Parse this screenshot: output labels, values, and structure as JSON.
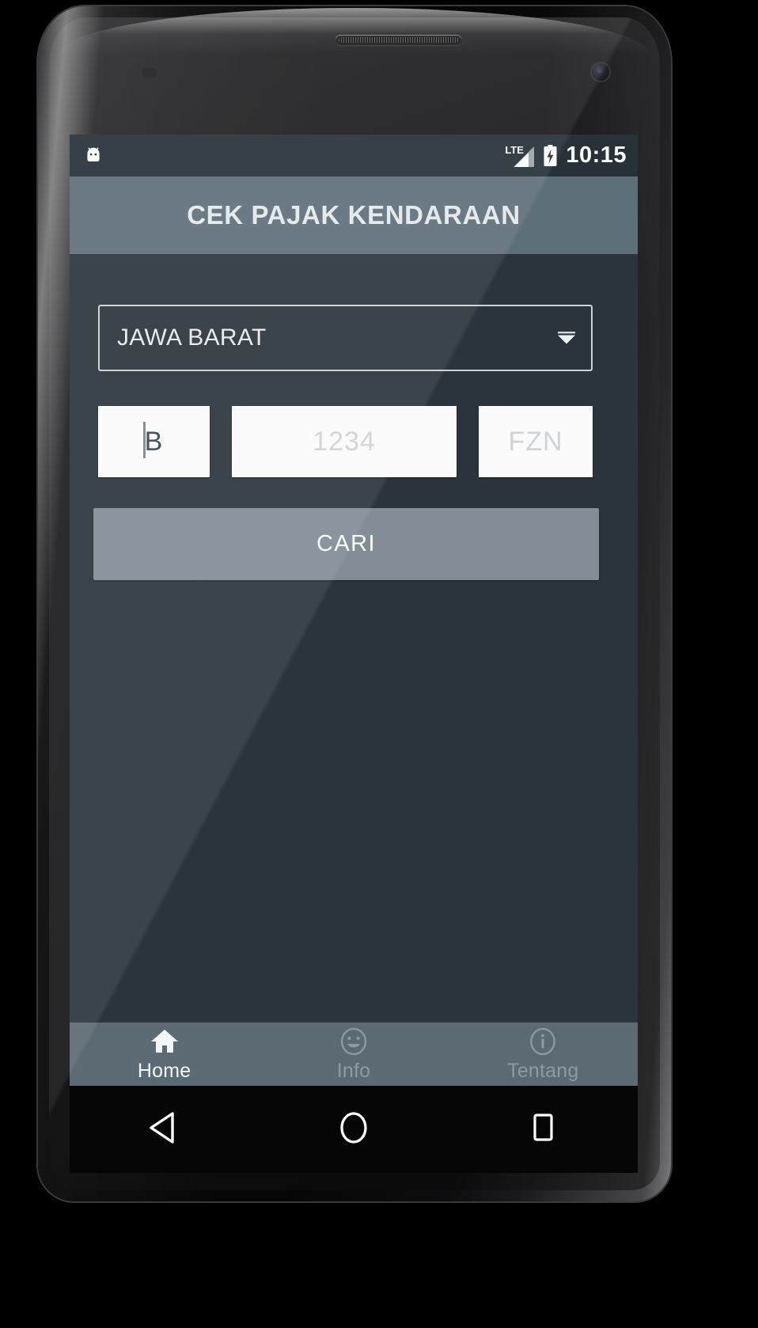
{
  "device": {
    "mockup": "android-phone-mockup",
    "earpiece": "earpiece-speaker",
    "camera": "front-camera",
    "sensor": "proximity-sensor"
  },
  "statusbar": {
    "notification_icon": "android-mascot-icon",
    "network_label": "LTE",
    "signal_icon": "signal-bars-icon",
    "battery_icon": "battery-charging-icon",
    "time": "10:15"
  },
  "actionbar": {
    "title": "CEK PAJAK KENDARAAN",
    "background": "#5f6f7a"
  },
  "form": {
    "region_spinner": {
      "value": "JAWA BARAT",
      "caret_icon": "chevron-down-icon"
    },
    "plate": {
      "code": {
        "value": "B",
        "placeholder": "B",
        "caret_visible": true
      },
      "number": {
        "value": "",
        "placeholder": "1234"
      },
      "suffix": {
        "value": "",
        "placeholder": "FZN"
      }
    },
    "submit_label": "CARI"
  },
  "tabbar": {
    "items": [
      {
        "label": "Home",
        "icon": "home-icon",
        "active": true
      },
      {
        "label": "Info",
        "icon": "smiley-face-icon",
        "active": false
      },
      {
        "label": "Tentang",
        "icon": "info-circle-icon",
        "active": false
      }
    ]
  },
  "navbar": {
    "back": "back-triangle-icon",
    "home": "home-circle-icon",
    "recents": "recents-square-icon"
  },
  "colors": {
    "screen_bg": "#2b343d",
    "statusbar_bg": "#263238",
    "actionbar_bg": "#5f6f7a",
    "button_bg": "#828d97",
    "tabbar_bg": "#5c6a73",
    "field_bg": "#fbfbfb",
    "accent_text": "#e6ebed"
  }
}
